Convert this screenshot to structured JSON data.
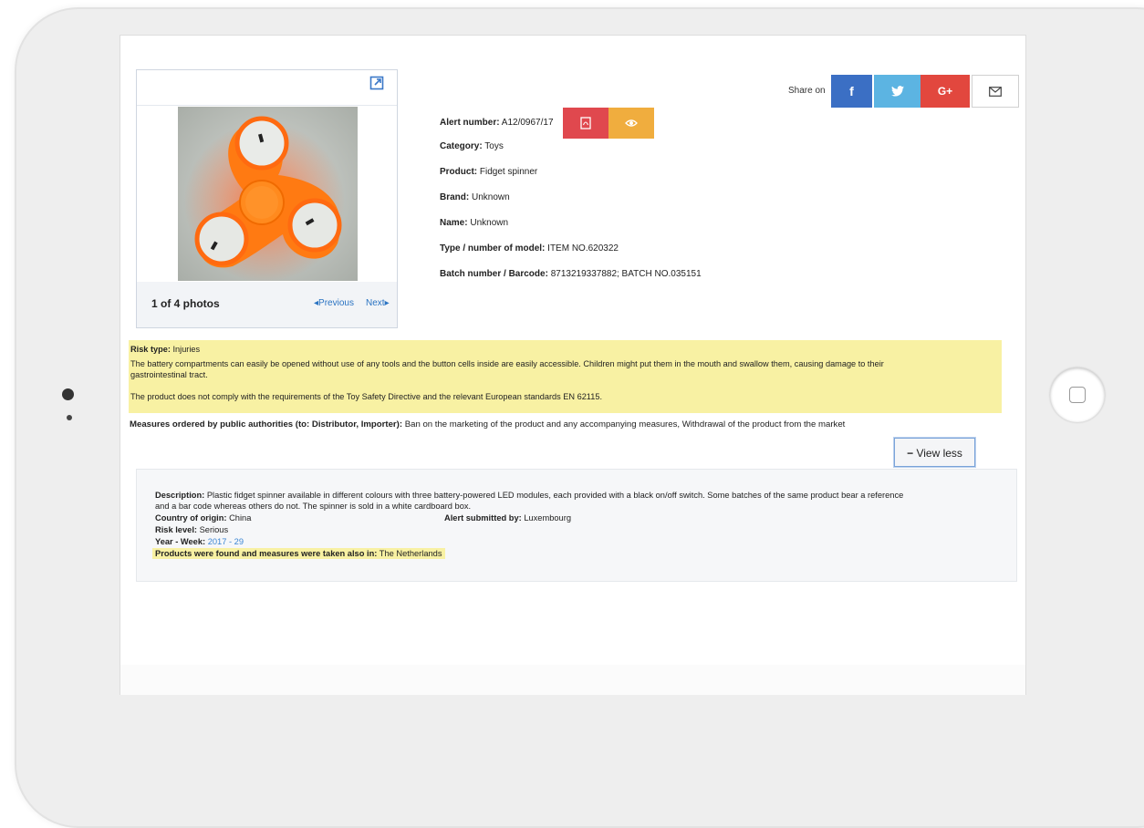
{
  "photo": {
    "count_label": "1 of 4 photos",
    "prev_label": "Previous",
    "next_label": "Next",
    "alt_icon": "expand-icon"
  },
  "alert": {
    "number_label": "Alert number:",
    "number_value": "A12/0967/17",
    "category_label": "Category:",
    "category_value": "Toys",
    "product_label": "Product:",
    "product_value": "Fidget spinner",
    "brand_label": "Brand:",
    "brand_value": "Unknown",
    "name_label": "Name:",
    "name_value": "Unknown",
    "model_label": "Type / number of model:",
    "model_value": "ITEM NO.620322",
    "batch_label": "Batch number / Barcode:",
    "batch_value": "8713219337882; BATCH NO.035151"
  },
  "share": {
    "label": "Share on",
    "facebook": "f",
    "google": "G+"
  },
  "risk": {
    "type_label": "Risk type:",
    "type_value": "Injuries",
    "text1": "The battery compartments can easily be opened without use of any tools and the button cells inside are easily accessible. Children might put them in the mouth and swallow them, causing damage to their",
    "text1b": "gastrointestinal tract.",
    "text2": "The product does not comply with the requirements of the Toy Safety Directive and the relevant European standards EN 62115."
  },
  "measures": {
    "label": "Measures ordered by public authorities (to: Distributor, Importer):",
    "value": "Ban on the marketing of the product and any accompanying measures, Withdrawal of the product from the market"
  },
  "view_less_label": "View less",
  "description": {
    "label": "Description:",
    "line1": "Plastic fidget spinner available in different colours with three battery-powered LED modules, each provided with a black on/off switch. Some batches of the same product bear a reference",
    "line2": "and a bar code whereas others do not. The spinner is sold in a white cardboard box.",
    "origin_label": "Country of origin:",
    "origin_value": "China",
    "submitted_label": "Alert submitted by:",
    "submitted_value": "Luxembourg",
    "risk_level_label": "Risk level:",
    "risk_level_value": "Serious",
    "year_week_label": "Year - Week:",
    "year_week_value": "2017 - 29",
    "found_label": "Products were found and measures were taken also in:",
    "found_value": "The Netherlands"
  },
  "colors": {
    "highlight": "#f8f1a3",
    "pdf_button": "#e0484e",
    "view_button": "#f0ad3e",
    "facebook": "#3b6fc4",
    "twitter": "#5cb4e2",
    "google": "#e2473e"
  }
}
